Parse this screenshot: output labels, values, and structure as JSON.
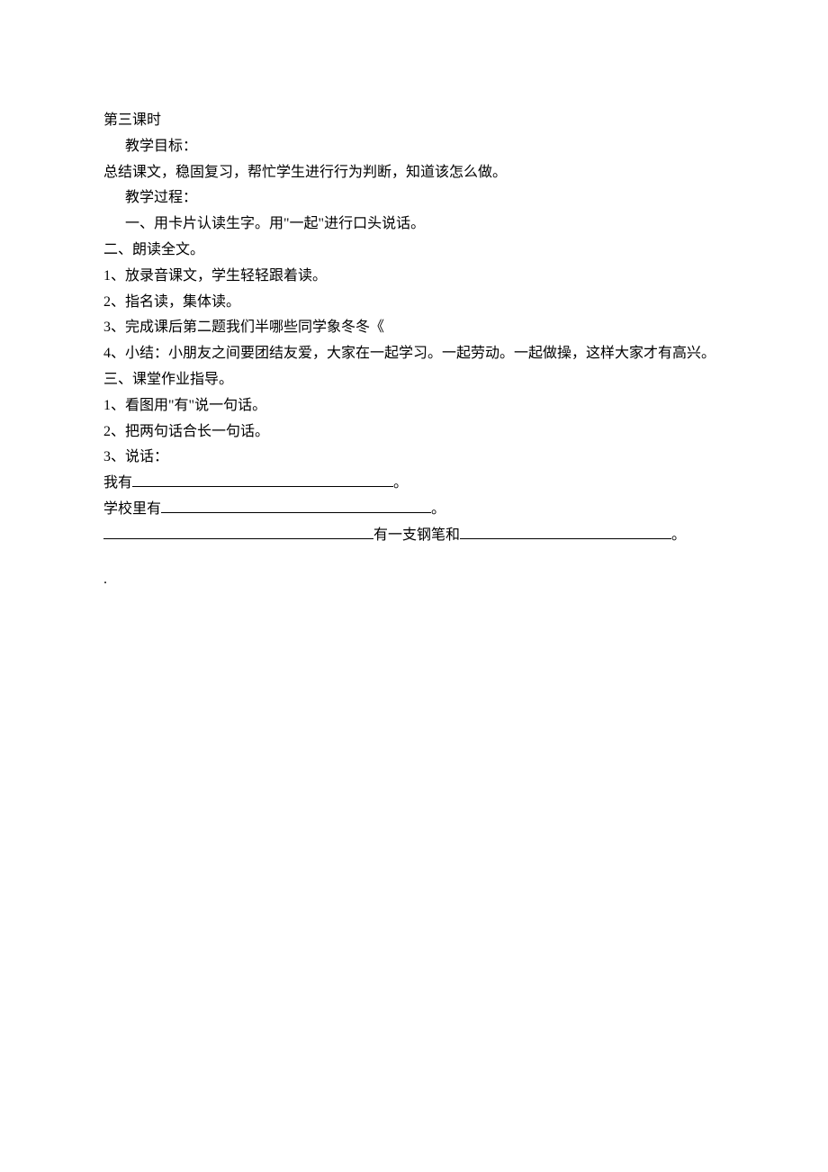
{
  "doc": {
    "title": "第三课时",
    "objective_label": "教学目标：",
    "objective_text": "总结课文，稳固复习，帮忙学生进行行为判断，知道该怎么做。",
    "process_label": "教学过程：",
    "section1": "一、用卡片认读生字。用\"一起\"进行口头说话。",
    "section2_title": "二、朗读全文。",
    "section2_item1": "1、放录音课文，学生轻轻跟着读。",
    "section2_item2": "2、指名读，集体读。",
    "section2_item3": "3、完成课后第二题我们半哪些同学象冬冬《",
    "section2_item4": "4、小结：小朋友之间要团结友爱，大家在一起学习。一起劳动。一起做操，这样大家才有高兴。",
    "section3_title": "三、课堂作业指导。",
    "section3_item1": "1、看图用\"有\"说一句话。",
    "section3_item2": "2、把两句话合长一句话。",
    "section3_item3": "3、说话：",
    "fill1_prefix": "我有",
    "fill1_suffix": "。",
    "fill2_prefix": "学校里有",
    "fill2_suffix": "。",
    "fill3_mid": "有一支钢笔和",
    "fill3_suffix": "。",
    "end_dot": "."
  }
}
